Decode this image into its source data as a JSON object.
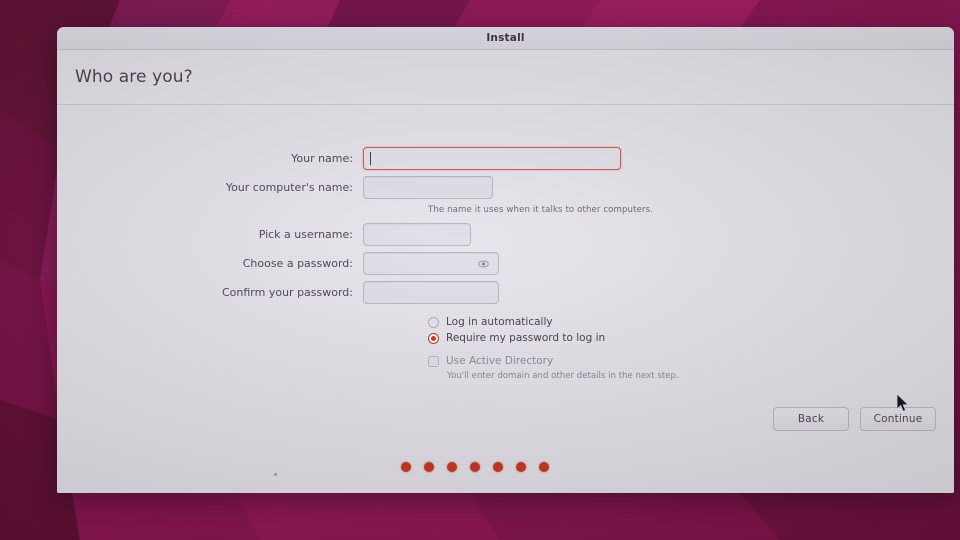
{
  "window": {
    "title": "Install",
    "page_title": "Who are you?"
  },
  "form": {
    "fields": [
      {
        "label": "Your name:",
        "value": "",
        "name": "your-name"
      },
      {
        "label": "Your computer's name:",
        "value": "",
        "name": "computer-name"
      },
      {
        "label": "Pick a username:",
        "value": "",
        "name": "username"
      },
      {
        "label": "Choose a password:",
        "value": "",
        "name": "password"
      },
      {
        "label": "Confirm your password:",
        "value": "",
        "name": "confirm-password"
      }
    ],
    "computer_name_hint": "The name it uses when it talks to other computers.",
    "password_reveal_icon": "eye-icon"
  },
  "options": {
    "login_automatically": "Log in automatically",
    "require_password": "Require my password to log in",
    "selected": "Require my password to log in",
    "use_active_directory": "Use Active Directory",
    "active_directory_checked": false,
    "active_directory_hint": "You'll enter domain and other details in the next step."
  },
  "buttons": {
    "back": "Back",
    "continue": "Continue"
  },
  "progress": {
    "dot_count": 7,
    "dot_color": "#cc3523"
  },
  "colors": {
    "accent": "#cc3523",
    "focus_border": "#d35d52",
    "window_bg": "#eae7ef",
    "wallpaper": "#8e1250"
  },
  "cursor": {
    "icon": "arrow-pointer-cursor"
  }
}
